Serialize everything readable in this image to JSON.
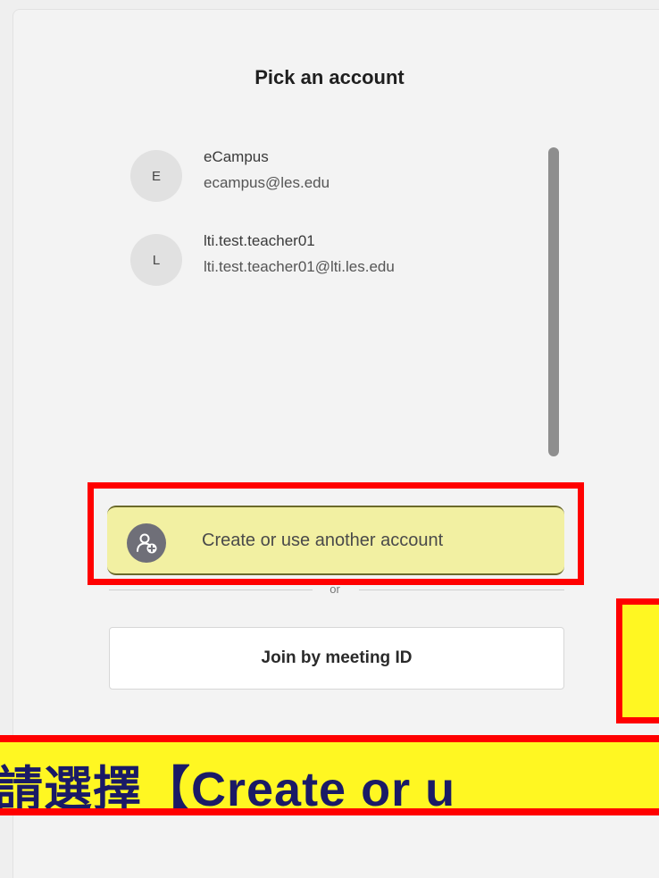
{
  "dialog": {
    "title": "Pick an account"
  },
  "accounts": [
    {
      "initial": "E",
      "name": "eCampus",
      "email": "ecampus@les.edu"
    },
    {
      "initial": "L",
      "name": "lti.test.teacher01",
      "email": "lti.test.teacher01@lti.les.edu"
    }
  ],
  "create_account": {
    "label": "Create or use another account",
    "icon": "add-person-icon",
    "highlight_color": "#f2f0a2"
  },
  "separator": {
    "text": "or"
  },
  "join_button": {
    "label": "Join by meeting ID"
  },
  "annotation": {
    "banner_text": "請選擇【Create or u",
    "banner_bg": "#fff722",
    "border_color": "#ff0000",
    "text_color": "#1a1a66"
  }
}
